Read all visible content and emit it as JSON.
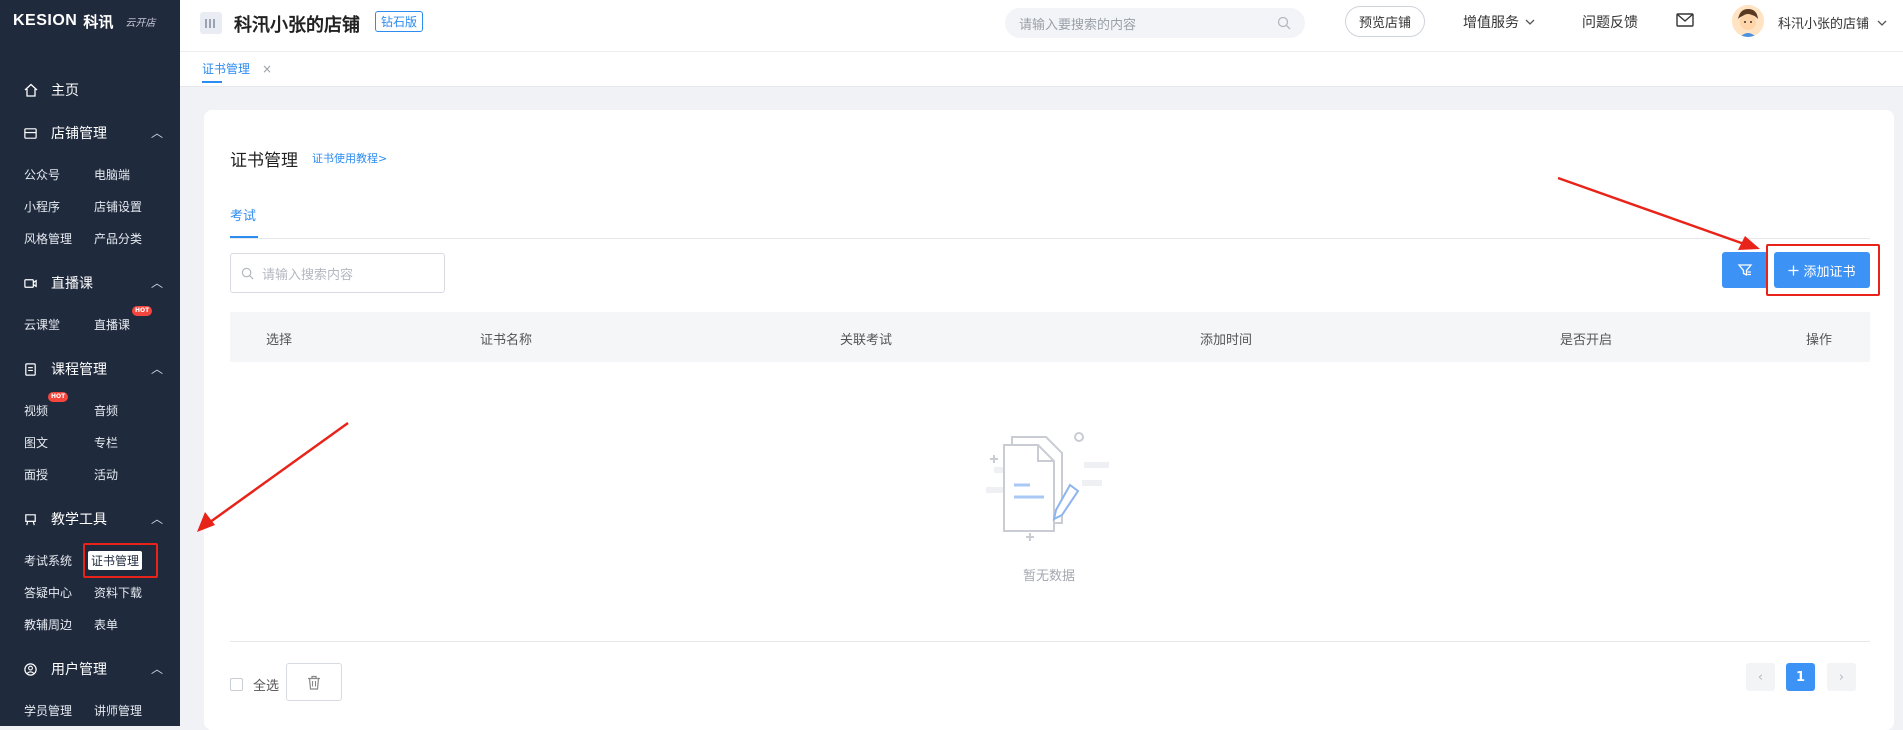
{
  "sidebar": {
    "logo": {
      "brand": "KESION",
      "cn": "科讯",
      "sub": "云开店"
    },
    "home": "主页",
    "sections": [
      {
        "label": "店铺管理",
        "items": [
          "公众号",
          "电脑端",
          "小程序",
          "店铺设置",
          "风格管理",
          "产品分类"
        ]
      },
      {
        "label": "直播课",
        "items": [
          "云课堂",
          "直播课"
        ]
      },
      {
        "label": "课程管理",
        "items": [
          "视频",
          "音频",
          "图文",
          "专栏",
          "面授",
          "活动"
        ]
      },
      {
        "label": "教学工具",
        "items": [
          "考试系统",
          "证书管理",
          "答疑中心",
          "资料下载",
          "教辅周边",
          "表单"
        ]
      },
      {
        "label": "用户管理",
        "items": [
          "学员管理",
          "讲师管理"
        ]
      }
    ],
    "hot_badge": "HOT",
    "active_item": "证书管理"
  },
  "topbar": {
    "store_title": "科汛小张的店铺",
    "tier": "钻石版",
    "search_placeholder": "请输入要搜索的内容",
    "preview": "预览店铺",
    "value_services": "增值服务",
    "feedback": "问题反馈",
    "user_name": "科汛小张的店铺"
  },
  "tabs": {
    "active": "证书管理",
    "close": "×"
  },
  "main": {
    "title": "证书管理",
    "tutorial": "证书使用教程>",
    "subtab": "考试",
    "search_placeholder": "请输入搜索内容",
    "add_button": "添加证书",
    "columns": [
      "选择",
      "证书名称",
      "关联考试",
      "添加时间",
      "是否开启",
      "操作"
    ],
    "empty_text": "暂无数据",
    "select_all": "全选",
    "pagination": {
      "current": "1",
      "prev": "‹",
      "next": "›"
    }
  },
  "colors": {
    "sidebar_bg": "#1f2a3c",
    "accent": "#3d93f5",
    "annotation_red": "#e8241a"
  }
}
